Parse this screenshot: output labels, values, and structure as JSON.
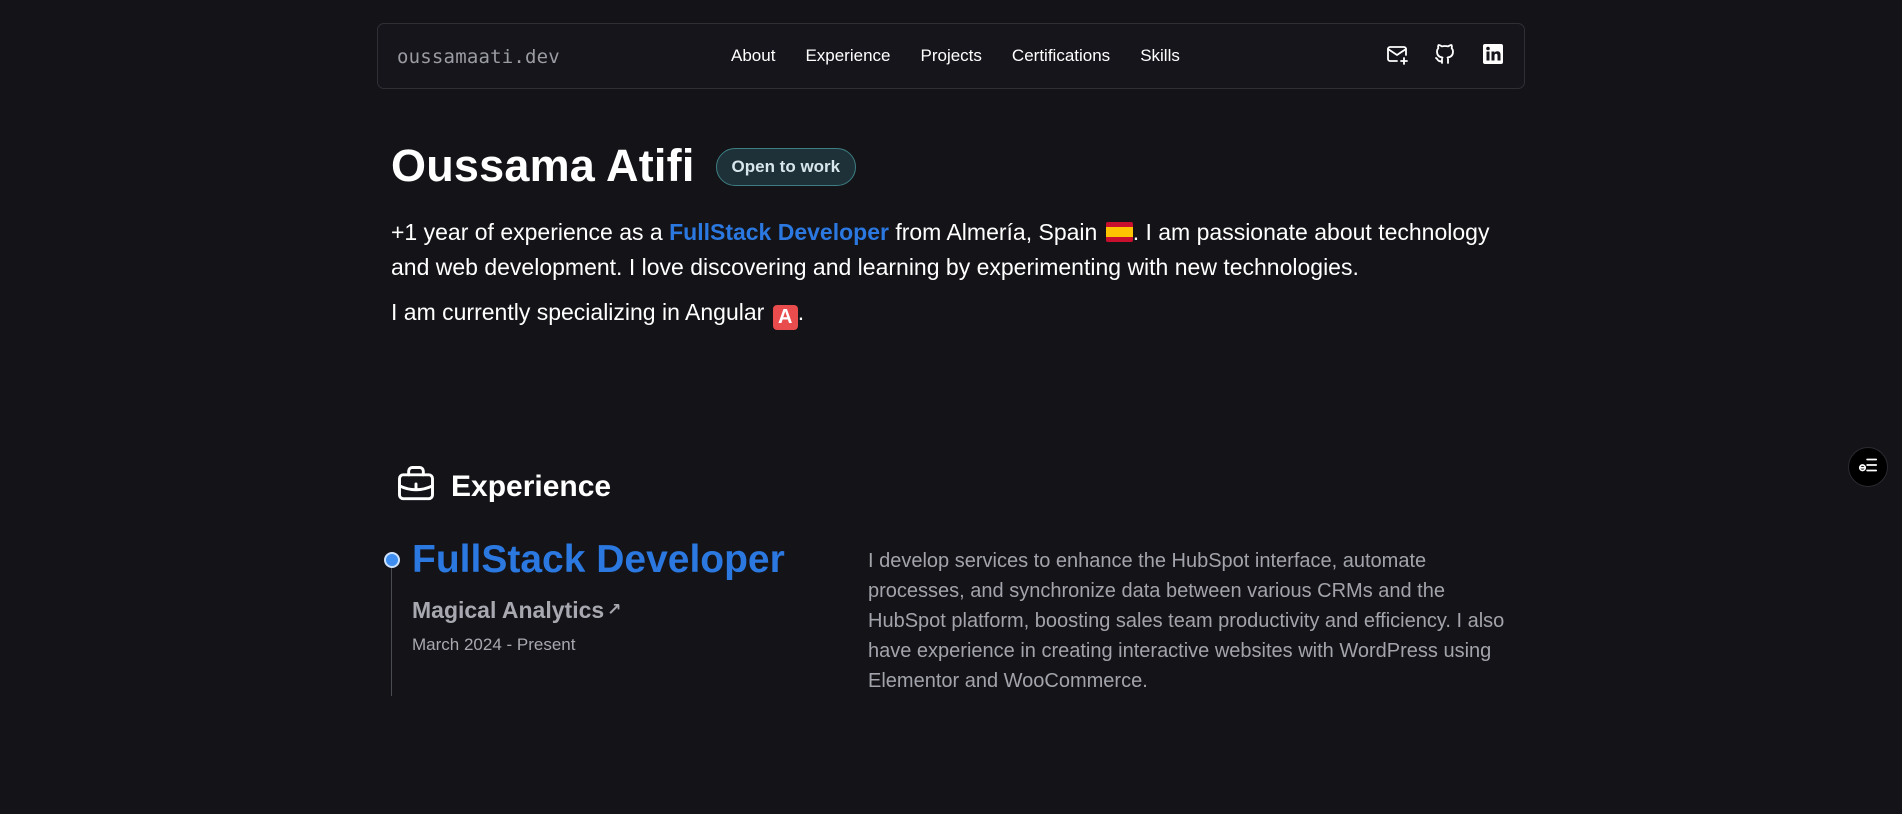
{
  "nav": {
    "brand": "oussamaati.dev",
    "links": [
      "About",
      "Experience",
      "Projects",
      "Certifications",
      "Skills"
    ],
    "icons": [
      "mail-icon",
      "github-icon",
      "linkedin-icon"
    ]
  },
  "hero": {
    "name": "Oussama Atifi",
    "badge": "Open to work",
    "intro_before": "+1 year of experience as a ",
    "intro_accent": "FullStack Developer",
    "intro_after": " from Almería, Spain ",
    "intro_rest": ". I am passionate about technology and web development. I love discovering and learning by experimenting with new technologies.",
    "line2_before": "I am currently specializing in Angular ",
    "line2_emoji": "A",
    "line2_after": "."
  },
  "experience": {
    "section_title": "Experience",
    "jobs": [
      {
        "title": "FullStack Developer",
        "company": "Magical Analytics",
        "company_arrow": "↗",
        "dates": "March 2024 - Present",
        "description": "I develop services to enhance the HubSpot interface, automate processes, and synchronize data between various CRMs and the HubSpot platform, boosting sales team productivity and efficiency. I also have experience in creating interactive websites with WordPress using Elementor and WooCommerce."
      }
    ]
  },
  "colors": {
    "background": "#131318",
    "accent": "#2b78e0",
    "muted_text": "#a3a3ab",
    "badge_border": "#3d7e82"
  },
  "floating": {
    "icon": "menu-list-icon"
  }
}
